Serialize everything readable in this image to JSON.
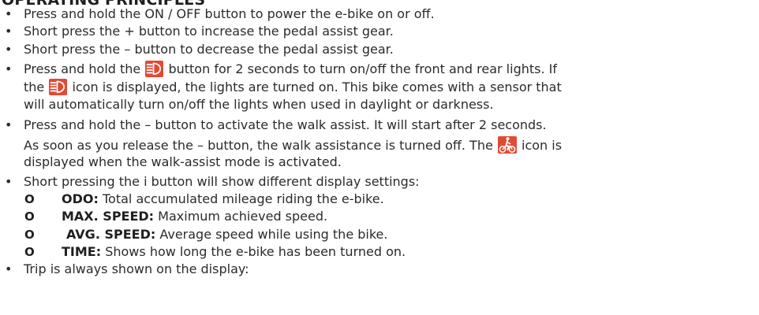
{
  "heading": "OPERATING PRINCIPLES",
  "bullet_char": "•",
  "sub_marker": "O",
  "colors": {
    "icon_background": "#e24a33",
    "icon_foreground": "#ffffff",
    "text": "#2b2b2b"
  },
  "icons": {
    "light": "headlight-icon",
    "walk": "walk-assist-icon"
  },
  "items": {
    "power": "Press and hold the ON / OFF button to power the e-bike on or off.",
    "plus": "Short press the + button to increase the pedal assist gear.",
    "minus": "Short press the – button to decrease the pedal assist gear.",
    "lights_a": "Press and hold the",
    "lights_b": "button for 2 seconds to turn on/off the front and rear lights. If",
    "lights_c": "the",
    "lights_d": "icon is displayed, the lights are turned on. This bike comes with a sensor that",
    "lights_e": "will automatically turn on/off the lights when used in daylight or darkness.",
    "walk_a": "Press and hold the – button to activate the walk assist. It will start after 2 seconds.",
    "walk_b": "As soon as you release the – button, the walk assistance is turned off. The",
    "walk_c": "icon is",
    "walk_d": "displayed when the walk-assist mode is activated.",
    "info": "Short pressing the i button will show different display settings:",
    "trip": "Trip is always shown on the display:"
  },
  "settings": [
    {
      "term": "ODO:",
      "desc": "Total accumulated mileage riding the e-bike."
    },
    {
      "term": "MAX. SPEED:",
      "desc": "Maximum achieved speed."
    },
    {
      "term": "AVG. SPEED:",
      "desc": "Average speed while using the bike."
    },
    {
      "term": "TIME:",
      "desc": "Shows how long the e-bike has been turned on."
    }
  ]
}
